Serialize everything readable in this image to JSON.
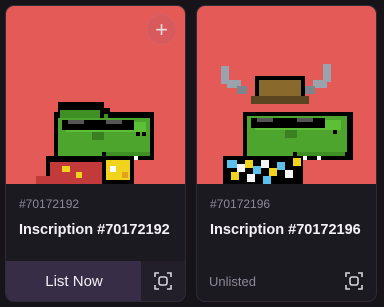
{
  "cards": [
    {
      "number": "#70172192",
      "title": "Inscription #70172192",
      "action_label": "List Now",
      "has_add_button": true,
      "add_icon": "plus",
      "scan_icon": "scan-frame-icon",
      "art_bg": "#e45a57"
    },
    {
      "number": "#70172196",
      "title": "Inscription #70172196",
      "status_label": "Unlisted",
      "scan_icon": "scan-frame-icon",
      "art_bg": "#e45a57"
    }
  ],
  "colors": {
    "page_bg": "#161419",
    "card_bg": "#1c1a21",
    "accent_button": "#372d47",
    "muted_text": "#8d8896",
    "title_text": "#f4f2f7"
  }
}
